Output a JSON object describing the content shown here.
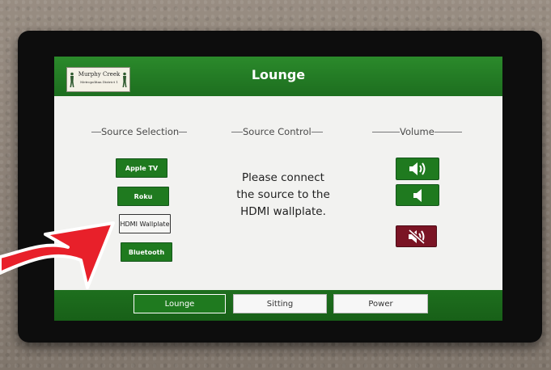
{
  "header": {
    "room_title": "Lounge",
    "logo": {
      "name": "Murphy Creek",
      "subtitle": "Metropolitan District 1"
    }
  },
  "sections": {
    "source_selection": "Source Selection",
    "source_control": "Source Control",
    "volume": "Volume"
  },
  "sources": [
    {
      "label": "Apple TV",
      "active": false
    },
    {
      "label": "Roku",
      "active": false
    },
    {
      "label": "HDMI Wallplate",
      "active": true
    },
    {
      "label": "Bluetooth",
      "active": false
    }
  ],
  "source_control": {
    "message_lines": [
      "Please connect",
      "the source to the",
      "HDMI wallplate."
    ]
  },
  "volume": {
    "up_icon": "speaker-loud-icon",
    "down_icon": "speaker-quiet-icon",
    "mute_icon": "speaker-mute-icon"
  },
  "footer_tabs": [
    {
      "label": "Lounge",
      "active": true
    },
    {
      "label": "Sitting",
      "active": false
    },
    {
      "label": "Power",
      "active": false
    }
  ],
  "colors": {
    "accent_green": "#1f7a1f",
    "header_green": "#2b8a2b",
    "mute_red": "#7a1424",
    "arrow_red": "#e8202a"
  }
}
